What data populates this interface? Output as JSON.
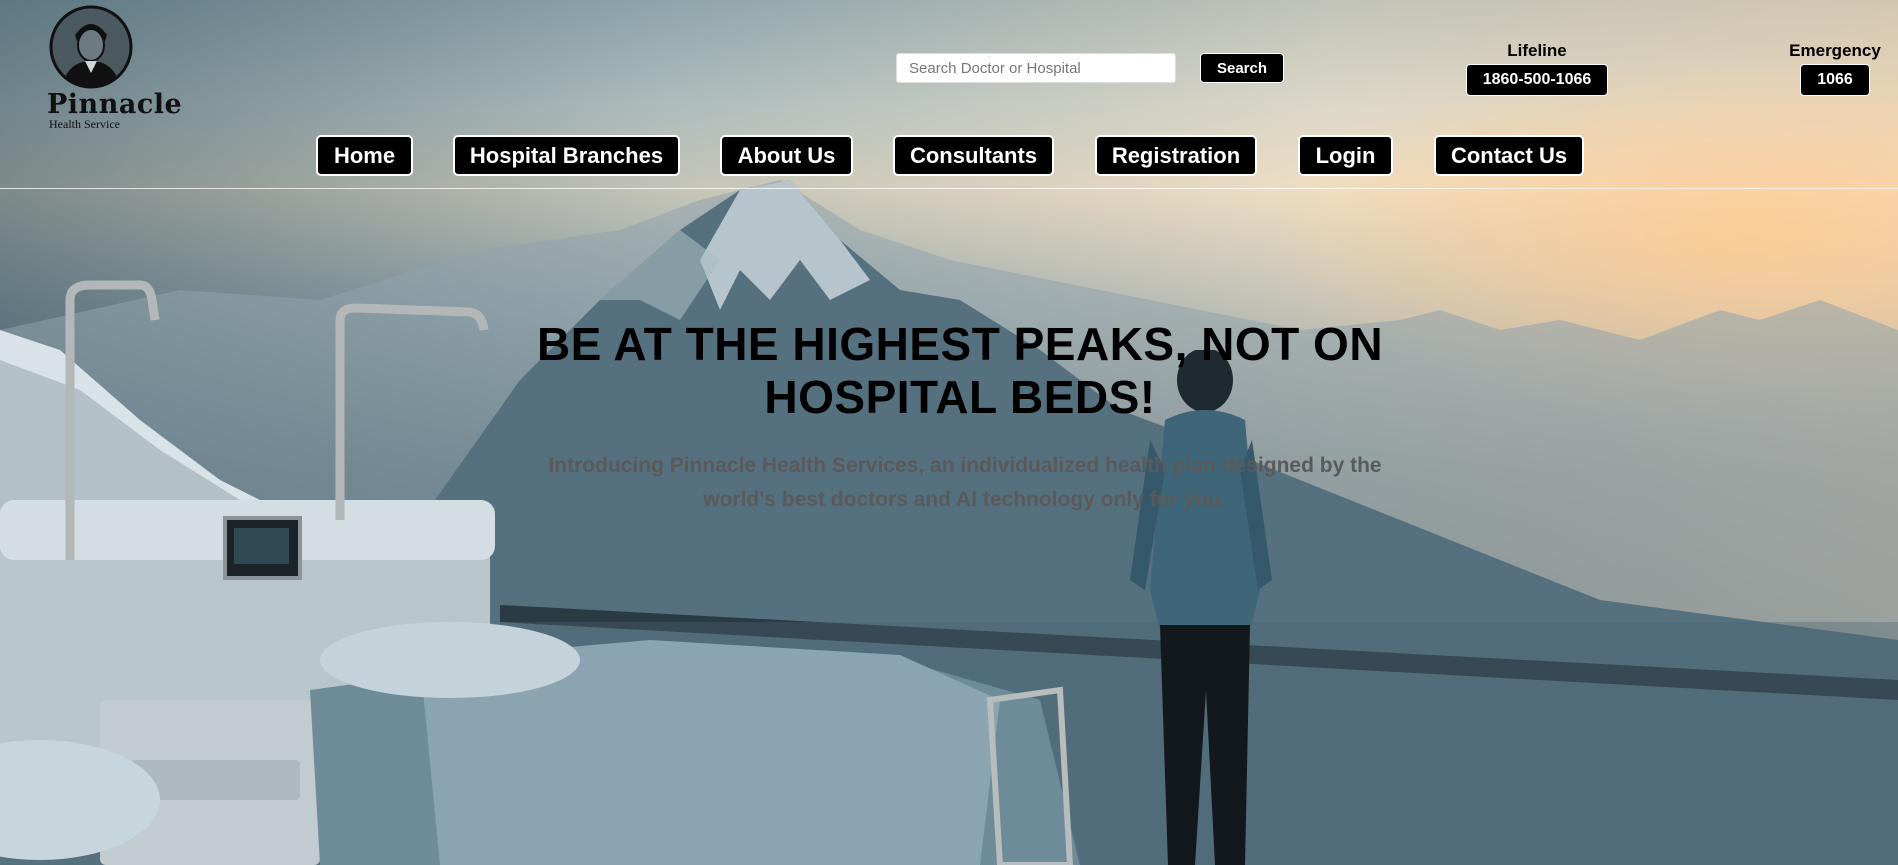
{
  "brand": {
    "name": "Pinnacle",
    "tagline": "Health Service"
  },
  "search": {
    "placeholder": "Search Doctor or Hospital",
    "value": "",
    "button_label": "Search"
  },
  "contacts": {
    "lifeline": {
      "label": "Lifeline",
      "number": "1860-500-1066"
    },
    "emergency": {
      "label": "Emergency",
      "number": "1066"
    }
  },
  "nav": {
    "items": [
      {
        "label": "Home"
      },
      {
        "label": "Hospital Branches"
      },
      {
        "label": "About Us"
      },
      {
        "label": "Consultants"
      },
      {
        "label": "Registration"
      },
      {
        "label": "Login"
      },
      {
        "label": "Contact Us"
      }
    ]
  },
  "hero": {
    "title_line1": "BE AT THE HIGHEST PEAKS, NOT ON",
    "title_line2": "HOSPITAL BEDS!",
    "subtitle_line1": "Introducing Pinnacle Health Services, an individualized health plan designed by the",
    "subtitle_line2": "world's best doctors and AI technology only for you."
  },
  "colors": {
    "button_bg": "#000000",
    "button_text": "#ffffff",
    "subtitle_text": "#5a5a5a"
  },
  "background": {
    "depicts": "hero-photo-hospital-bed-mountain-sunset"
  }
}
